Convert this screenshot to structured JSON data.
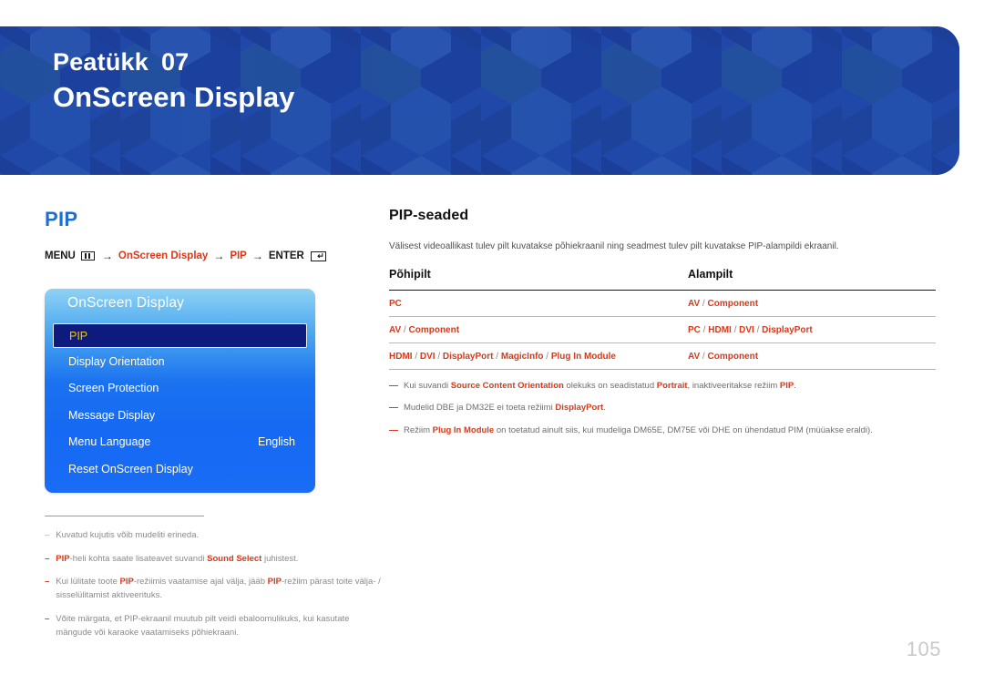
{
  "header": {
    "chapter_label": "Peatükk",
    "chapter_number": "07",
    "title": "OnScreen Display",
    "banner_color": "#1f48a8"
  },
  "left": {
    "section_title": "PIP",
    "section_title_color": "#1d6fd4",
    "menu_path": {
      "menu_label": "MENU",
      "menu_icon": "menu-grid-icon",
      "arrow1": "→",
      "step1": "OnScreen Display",
      "arrow2": "→",
      "step2": "PIP",
      "arrow3": "→",
      "enter_label": "ENTER",
      "enter_icon": "enter-return-icon",
      "accent_color": "#d8391a"
    },
    "osd": {
      "title": "OnScreen Display",
      "items": [
        {
          "label": "PIP",
          "value": "",
          "selected": true
        },
        {
          "label": "Display Orientation",
          "value": "",
          "selected": false
        },
        {
          "label": "Screen Protection",
          "value": "",
          "selected": false
        },
        {
          "label": "Message Display",
          "value": "",
          "selected": false
        },
        {
          "label": "Menu Language",
          "value": "English",
          "selected": false
        },
        {
          "label": "Reset OnScreen Display",
          "value": "",
          "selected": false
        }
      ],
      "selected_text_color": "#f2c40e",
      "selected_bg_color": "#0d1b7e"
    },
    "notes": [
      {
        "dash": "–",
        "dash_style": "gray",
        "parts": [
          {
            "t": "Kuvatud kujutis võib mudeliti erineda.",
            "b": false
          }
        ]
      },
      {
        "dash": "–",
        "dash_style": "red",
        "parts": [
          {
            "t": "PIP",
            "b": true
          },
          {
            "t": "-heli kohta saate lisateavet suvandi ",
            "b": false
          },
          {
            "t": "Sound Select",
            "b": true
          },
          {
            "t": " juhistest.",
            "b": false
          }
        ]
      },
      {
        "dash": "–",
        "dash_style": "red",
        "parts": [
          {
            "t": "Kui lülitate toote ",
            "b": false
          },
          {
            "t": "PIP",
            "b": true
          },
          {
            "t": "-režiimis vaatamise ajal välja, jääb ",
            "b": false
          },
          {
            "t": "PIP",
            "b": true
          },
          {
            "t": "-režiim pärast toite välja- / sisselülitamist aktiveerituks.",
            "b": false
          }
        ]
      },
      {
        "dash": "–",
        "dash_style": "red",
        "parts": [
          {
            "t": "Võite märgata, et PIP-ekraanil muutub pilt veidi ebaloomulikuks, kui kasutate mängude või karaoke vaatamiseks põhiekraani.",
            "b": false
          }
        ]
      }
    ]
  },
  "right": {
    "sub_title": "PIP-seaded",
    "intro": "Välisest videoallikast tulev pilt kuvatakse põhiekraanil ning seadmest tulev pilt kuvatakse PIP-alampildi ekraanil.",
    "table": {
      "headers": [
        "Põhipilt",
        "Alampilt"
      ],
      "rows": [
        {
          "main": [
            "PC"
          ],
          "sub": [
            "AV",
            "Component"
          ]
        },
        {
          "main": [
            "AV",
            "Component"
          ],
          "sub": [
            "PC",
            "HDMI",
            "DVI",
            "DisplayPort"
          ]
        },
        {
          "main": [
            "HDMI",
            "DVI",
            "DisplayPort",
            "MagicInfo",
            "Plug In Module"
          ],
          "sub": [
            "AV",
            "Component"
          ]
        }
      ],
      "separator": "/",
      "value_color": "#d8391a"
    },
    "notes": [
      {
        "parts": [
          {
            "t": "Kui suvandi ",
            "b": false
          },
          {
            "t": "Source Content Orientation",
            "b": true
          },
          {
            "t": " olekuks on seadistatud ",
            "b": false
          },
          {
            "t": "Portrait",
            "b": true
          },
          {
            "t": ", inaktiveeritakse režiim ",
            "b": false
          },
          {
            "t": "PIP",
            "b": true
          },
          {
            "t": ".",
            "b": false
          }
        ]
      },
      {
        "parts": [
          {
            "t": "Mudelid DBE ja DM32E ei toeta režiimi ",
            "b": false
          },
          {
            "t": "DisplayPort",
            "b": true
          },
          {
            "t": ".",
            "b": false
          }
        ]
      },
      {
        "parts": [
          {
            "t": "Režiim ",
            "b": false
          },
          {
            "t": "Plug In Module",
            "b": true
          },
          {
            "t": " on toetatud ainult siis, kui mudeliga DM65E, DM75E või DHE on ühendatud PIM (müüakse eraldi).",
            "b": false
          }
        ]
      }
    ]
  },
  "footer": {
    "page_number": "105"
  }
}
